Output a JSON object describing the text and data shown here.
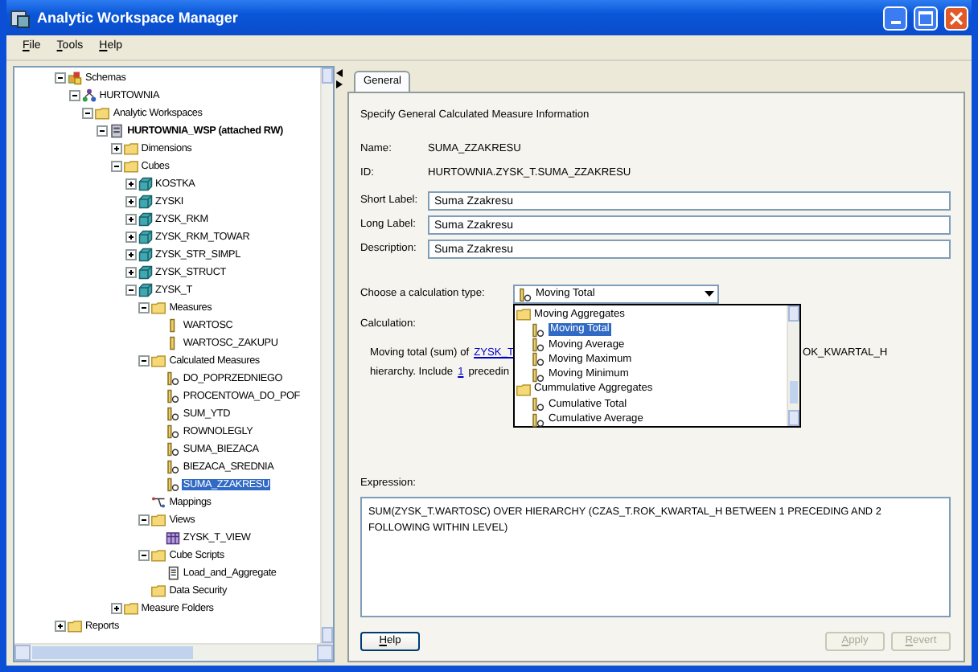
{
  "window": {
    "title": "Analytic Workspace Manager"
  },
  "menu": [
    "File",
    "Tools",
    "Help"
  ],
  "tree": [
    {
      "label": "Schemas",
      "kind": "schema",
      "expanded": true,
      "selected": false,
      "children": [
        {
          "label": "HURTOWNIA",
          "kind": "user",
          "expanded": true,
          "selected": false,
          "children": [
            {
              "label": "Analytic Workspaces",
              "kind": "folder",
              "expanded": true,
              "selected": false,
              "children": [
                {
                  "label": "HURTOWNIA_WSP (attached RW)",
                  "kind": "workspace",
                  "expanded": true,
                  "selected": false,
                  "children": [
                    {
                      "label": "Dimensions",
                      "kind": "folder",
                      "expanded": false,
                      "selected": false
                    },
                    {
                      "label": "Cubes",
                      "kind": "folder",
                      "expanded": true,
                      "selected": false,
                      "children": [
                        {
                          "label": "KOSTKA",
                          "kind": "cube",
                          "expanded": false,
                          "selected": false
                        },
                        {
                          "label": "ZYSKI",
                          "kind": "cube",
                          "expanded": false,
                          "selected": false
                        },
                        {
                          "label": "ZYSK_RKM",
                          "kind": "cube",
                          "expanded": false,
                          "selected": false
                        },
                        {
                          "label": "ZYSK_RKM_TOWAR",
                          "kind": "cube",
                          "expanded": false,
                          "selected": false
                        },
                        {
                          "label": "ZYSK_STR_SIMPL",
                          "kind": "cube",
                          "expanded": false,
                          "selected": false
                        },
                        {
                          "label": "ZYSK_STRUCT",
                          "kind": "cube",
                          "expanded": false,
                          "selected": false
                        },
                        {
                          "label": "ZYSK_T",
                          "kind": "cube",
                          "expanded": true,
                          "selected": false,
                          "children": [
                            {
                              "label": "Measures",
                              "kind": "folder",
                              "expanded": true,
                              "selected": false,
                              "children": [
                                {
                                  "label": "WARTOSC",
                                  "kind": "measure",
                                  "selected": false
                                },
                                {
                                  "label": "WARTOSC_ZAKUPU",
                                  "kind": "measure",
                                  "selected": false
                                }
                              ]
                            },
                            {
                              "label": "Calculated Measures",
                              "kind": "folder",
                              "expanded": true,
                              "selected": false,
                              "children": [
                                {
                                  "label": "DO_POPRZEDNIEGO",
                                  "kind": "calc",
                                  "selected": false
                                },
                                {
                                  "label": "PROCENTOWA_DO_POF",
                                  "kind": "calc",
                                  "selected": false
                                },
                                {
                                  "label": "SUM_YTD",
                                  "kind": "calc",
                                  "selected": false
                                },
                                {
                                  "label": "ROWNOLEGLY",
                                  "kind": "calc",
                                  "selected": false
                                },
                                {
                                  "label": "SUMA_BIEZACA",
                                  "kind": "calc",
                                  "selected": false
                                },
                                {
                                  "label": "BIEZACA_SREDNIA",
                                  "kind": "calc",
                                  "selected": false
                                },
                                {
                                  "label": "SUMA_ZZAKRESU",
                                  "kind": "calc",
                                  "selected": true
                                }
                              ]
                            },
                            {
                              "label": "Mappings",
                              "kind": "mapping",
                              "selected": false
                            },
                            {
                              "label": "Views",
                              "kind": "folder",
                              "expanded": true,
                              "selected": false,
                              "children": [
                                {
                                  "label": "ZYSK_T_VIEW",
                                  "kind": "view",
                                  "selected": false
                                }
                              ]
                            },
                            {
                              "label": "Cube Scripts",
                              "kind": "folder",
                              "expanded": true,
                              "selected": false,
                              "children": [
                                {
                                  "label": "Load_and_Aggregate",
                                  "kind": "script",
                                  "selected": false
                                }
                              ]
                            },
                            {
                              "label": "Data Security",
                              "kind": "folder",
                              "selected": false
                            }
                          ]
                        }
                      ]
                    },
                    {
                      "label": "Measure Folders",
                      "kind": "folder",
                      "expanded": false,
                      "selected": false
                    }
                  ]
                }
              ]
            }
          ]
        }
      ]
    },
    {
      "label": "Reports",
      "kind": "folder",
      "expanded": false,
      "selected": false
    }
  ],
  "tabs": [
    {
      "label": "General",
      "selected": true
    }
  ],
  "heading": "Specify General Calculated Measure Information",
  "info": [
    {
      "label": "Name:",
      "value": "SUMA_ZZAKRESU"
    },
    {
      "label": "ID:",
      "value": "HURTOWNIA.ZYSK_T.SUMA_ZZAKRESU"
    }
  ],
  "fields": [
    {
      "label": "Short Label:",
      "value": "Suma Zzakresu"
    },
    {
      "label": "Long Label:",
      "value": "Suma Zzakresu"
    },
    {
      "label": "Description:",
      "value": "Suma Zzakresu"
    }
  ],
  "calc_type": {
    "label": "Choose a calculation type:",
    "value": "Moving Total",
    "options": [
      {
        "label": "Moving Aggregates",
        "kind": "group",
        "selected": false
      },
      {
        "label": "Moving Total",
        "kind": "option",
        "selected": true
      },
      {
        "label": "Moving Average",
        "kind": "option",
        "selected": false
      },
      {
        "label": "Moving Maximum",
        "kind": "option",
        "selected": false
      },
      {
        "label": "Moving Minimum",
        "kind": "option",
        "selected": false
      },
      {
        "label": "Cummulative Aggregates",
        "kind": "group",
        "selected": false
      },
      {
        "label": "Cumulative Total",
        "kind": "option",
        "selected": false
      },
      {
        "label": "Cumulative Average",
        "kind": "option",
        "selected": false
      }
    ]
  },
  "calculation": {
    "label": "Calculation:",
    "lines": [
      {
        "before": [
          {
            "text": "Moving total (sum) of",
            "kind": "text"
          },
          {
            "text": "ZYSK_T",
            "kind": "link"
          }
        ],
        "after": [
          {
            "text": "OK_KWARTAL_H",
            "kind": "text"
          }
        ]
      },
      {
        "before": [
          {
            "text": "hierarchy. Include",
            "kind": "text"
          },
          {
            "text": "1",
            "kind": "link"
          },
          {
            "text": "precedin",
            "kind": "text"
          }
        ]
      }
    ]
  },
  "expression": {
    "label": "Expression:",
    "value": "SUM(ZYSK_T.WARTOSC) OVER HIERARCHY (CZAS_T.ROK_KWARTAL_H BETWEEN 1 PRECEDING AND 2 FOLLOWING WITHIN LEVEL)"
  },
  "buttons": [
    {
      "label": "Help",
      "disabled": false
    },
    {
      "label": "Apply",
      "disabled": true
    },
    {
      "label": "Revert",
      "disabled": true
    }
  ]
}
